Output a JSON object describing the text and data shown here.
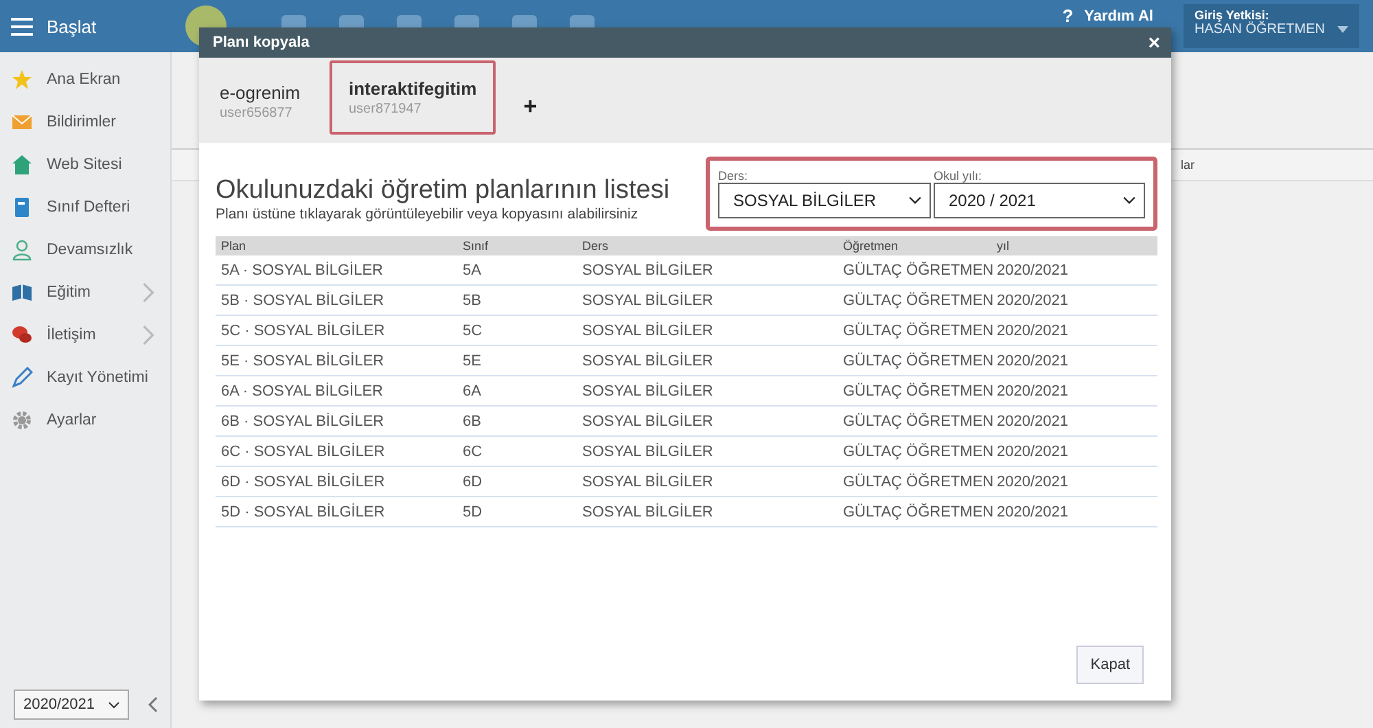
{
  "topbar": {
    "start_label": "Başlat",
    "help_label": "Yardım Al",
    "help_mark": "?",
    "role": {
      "label": "Giriş Yetkisi:",
      "value": "HASAN ÖĞRETMEN"
    }
  },
  "sidebar": {
    "items": [
      {
        "label": "Ana Ekran",
        "submenu": false
      },
      {
        "label": "Bildirimler",
        "submenu": false
      },
      {
        "label": "Web Sitesi",
        "submenu": false
      },
      {
        "label": "Sınıf Defteri",
        "submenu": false
      },
      {
        "label": "Devamsızlık",
        "submenu": false
      },
      {
        "label": "Eğitim",
        "submenu": true
      },
      {
        "label": "İletişim",
        "submenu": true
      },
      {
        "label": "Kayıt Yönetimi",
        "submenu": false
      },
      {
        "label": "Ayarlar",
        "submenu": false
      }
    ],
    "year_select": "2020/2021"
  },
  "background": {
    "table_header_fragment": "lar"
  },
  "dialog": {
    "title": "Planı kopyala",
    "close": "×",
    "tabs": [
      {
        "name": "e-ogrenim",
        "user": "user656877",
        "selected": false,
        "highlighted": false
      },
      {
        "name": "interaktifegitim",
        "user": "user871947",
        "selected": true,
        "highlighted": true
      }
    ],
    "add_tab": "+",
    "heading": "Okulunuzdaki öğretim planlarının listesi",
    "subheading": "Planı üstüne tıklayarak görüntüleyebilir veya kopyasını alabilirsiniz",
    "filters": {
      "highlighted": true,
      "items": [
        {
          "label": "Ders:",
          "value": "SOSYAL BİLGİLER"
        },
        {
          "label": "Okul yılı:",
          "value": "2020 / 2021"
        }
      ]
    },
    "table": {
      "columns": [
        "Plan",
        "Sınıf",
        "Ders",
        "Öğretmen",
        "yıl"
      ],
      "rows": [
        [
          "5A · SOSYAL BİLGİLER",
          "5A",
          "SOSYAL BİLGİLER",
          "GÜLTAÇ ÖĞRETMEN",
          "2020/2021"
        ],
        [
          "5B · SOSYAL BİLGİLER",
          "5B",
          "SOSYAL BİLGİLER",
          "GÜLTAÇ ÖĞRETMEN",
          "2020/2021"
        ],
        [
          "5C · SOSYAL BİLGİLER",
          "5C",
          "SOSYAL BİLGİLER",
          "GÜLTAÇ ÖĞRETMEN",
          "2020/2021"
        ],
        [
          "5E · SOSYAL BİLGİLER",
          "5E",
          "SOSYAL BİLGİLER",
          "GÜLTAÇ ÖĞRETMEN",
          "2020/2021"
        ],
        [
          "6A · SOSYAL BİLGİLER",
          "6A",
          "SOSYAL BİLGİLER",
          "GÜLTAÇ ÖĞRETMEN",
          "2020/2021"
        ],
        [
          "6B · SOSYAL BİLGİLER",
          "6B",
          "SOSYAL BİLGİLER",
          "GÜLTAÇ ÖĞRETMEN",
          "2020/2021"
        ],
        [
          "6C · SOSYAL BİLGİLER",
          "6C",
          "SOSYAL BİLGİLER",
          "GÜLTAÇ ÖĞRETMEN",
          "2020/2021"
        ],
        [
          "6D · SOSYAL BİLGİLER",
          "6D",
          "SOSYAL BİLGİLER",
          "GÜLTAÇ ÖĞRETMEN",
          "2020/2021"
        ],
        [
          "5D · SOSYAL BİLGİLER",
          "5D",
          "SOSYAL BİLGİLER",
          "GÜLTAÇ ÖĞRETMEN",
          "2020/2021"
        ]
      ]
    },
    "buttons": [
      "Kapat"
    ]
  }
}
